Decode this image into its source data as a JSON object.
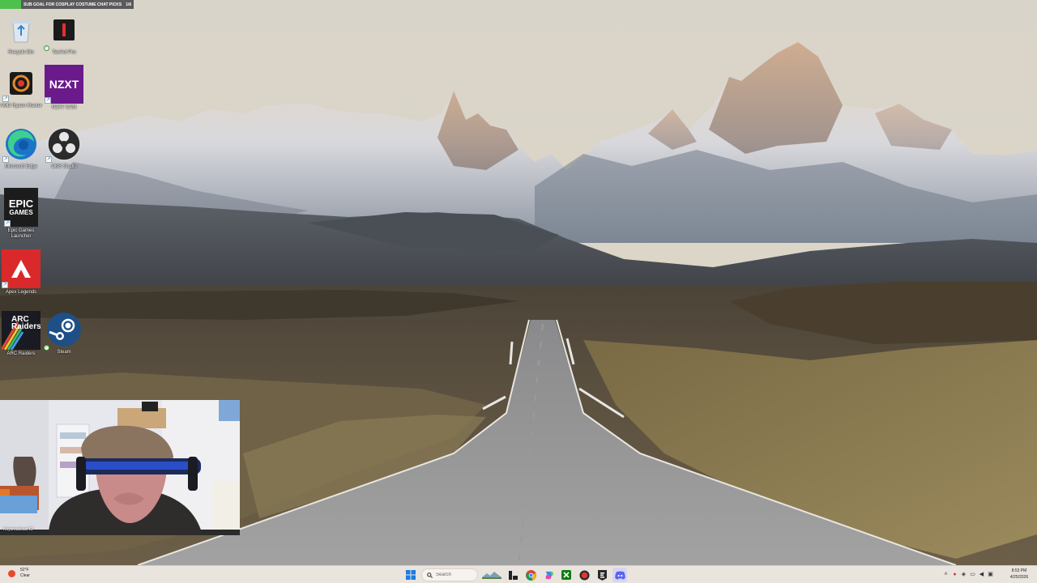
{
  "stream_overlay": {
    "goal_text": "SUB GOAL FOR COSPLAY COSTUME CHAT PICKS",
    "goal_count": "1/6"
  },
  "desktop_icons": [
    {
      "label": "Recycle Bin",
      "icon": "recycle-bin-icon"
    },
    {
      "label": "TaxAct Pro",
      "icon": "taxact-icon"
    },
    {
      "label": "AMD Ryzen Master",
      "icon": "ryzen-master-icon"
    },
    {
      "label": "NZXT CAM",
      "icon": "nzxt-cam-icon",
      "tile_text": "NZXT"
    },
    {
      "label": "Microsoft Edge",
      "icon": "edge-icon"
    },
    {
      "label": "OBS Studio",
      "icon": "obs-studio-icon"
    },
    {
      "label": "Epic Games Launcher",
      "icon": "epic-games-icon",
      "tile_text_1": "EPIC",
      "tile_text_2": "GAMES"
    },
    {
      "label": "Apex Legends",
      "icon": "apex-legends-icon"
    },
    {
      "label": "ARC Raiders",
      "icon": "arc-raiders-icon",
      "tile_text_1": "ARC",
      "tile_text_2": "Raiders"
    },
    {
      "label": "Steam",
      "icon": "steam-icon"
    }
  ],
  "webcam": {
    "label": "Keybroadcast ID"
  },
  "taskbar": {
    "weather": {
      "temp": "52°F",
      "condition": "Clear"
    },
    "search_placeholder": "Search",
    "apps": [
      {
        "name": "start-button",
        "icon": "windows-logo-icon"
      },
      {
        "name": "task-view",
        "icon": "task-view-icon"
      },
      {
        "name": "widgets",
        "icon": "widgets-icon"
      },
      {
        "name": "chrome",
        "icon": "chrome-icon"
      },
      {
        "name": "copilot",
        "icon": "copilot-icon"
      },
      {
        "name": "xbox",
        "icon": "xbox-icon"
      },
      {
        "name": "app-red",
        "icon": "red-app-icon"
      },
      {
        "name": "epic",
        "icon": "epic-small-icon"
      },
      {
        "name": "discord",
        "icon": "discord-icon"
      }
    ],
    "clock": {
      "time": "8:53 PM",
      "date": "4/25/2026"
    }
  },
  "colors": {
    "taskbar_bg": "#e9e4de",
    "goal_fill": "#4ec04e",
    "nzxt": "#6b1a8c",
    "apex": "#da292a"
  }
}
